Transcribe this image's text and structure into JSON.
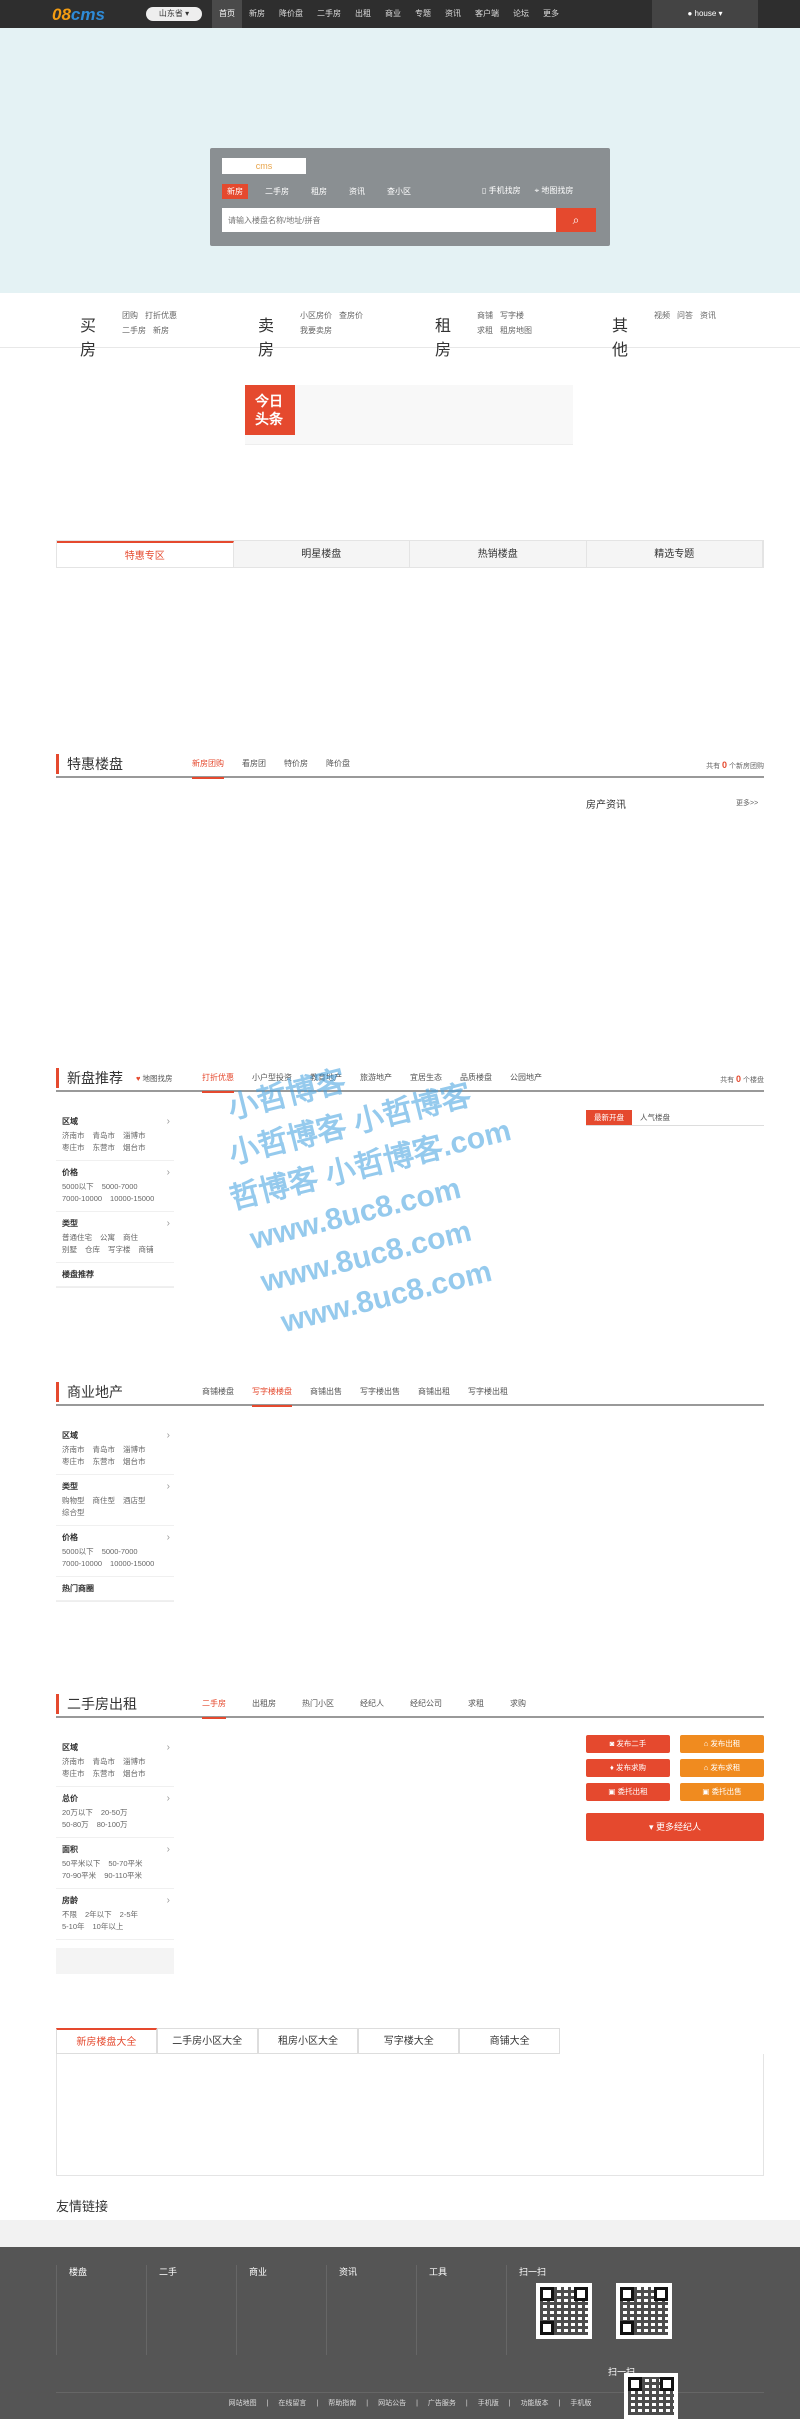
{
  "topbar": {
    "logo_a": "08",
    "logo_b": "cms",
    "city": "山东省",
    "nav": [
      "首页",
      "新房",
      "降价盘",
      "二手房",
      "出租",
      "商业",
      "专题",
      "资讯",
      "客户端",
      "论坛",
      "更多"
    ],
    "user": "house"
  },
  "search": {
    "logo_text": "cms",
    "tabs": [
      "新房",
      "二手房",
      "租房",
      "资讯",
      "查小区"
    ],
    "phone_label": "手机找房",
    "map_label": "地图找房",
    "placeholder": "请输入楼盘名称/地址/拼音"
  },
  "categories": [
    {
      "name": "买房",
      "links": [
        "团购",
        "打折优惠",
        "二手房",
        "新房"
      ]
    },
    {
      "name": "卖房",
      "links": [
        "小区房价",
        "查房价",
        "我要卖房"
      ]
    },
    {
      "name": "租房",
      "links": [
        "商铺",
        "写字楼",
        "求租",
        "租房地图"
      ]
    },
    {
      "name": "其他",
      "links": [
        "视频",
        "问答",
        "资讯"
      ]
    }
  ],
  "headline": {
    "tag1": "今日",
    "tag2": "头条"
  },
  "feature_tabs": [
    "特惠专区",
    "明星楼盘",
    "热销楼盘",
    "精选专题"
  ],
  "tehui": {
    "title": "特惠楼盘",
    "tabs": [
      "新房团购",
      "看房团",
      "特价房",
      "降价盘"
    ],
    "count_pre": "共有",
    "count": "0",
    "count_post": "个新房团购",
    "news_title": "房产资讯",
    "more": "更多>>"
  },
  "newhouse": {
    "title": "新盘推荐",
    "map": "地图找房",
    "tabs": [
      "打折优惠",
      "小户型投资",
      "教育地产",
      "旅游地产",
      "宜居生态",
      "品质楼盘",
      "公园地产"
    ],
    "count_pre": "共有",
    "count": "0",
    "count_post": "个楼盘",
    "mini_tabs": [
      "最新开盘",
      "人气楼盘"
    ],
    "filters": [
      {
        "h": "区域",
        "items": [
          "济南市",
          "青岛市",
          "淄博市",
          "枣庄市",
          "东营市",
          "烟台市"
        ]
      },
      {
        "h": "价格",
        "items": [
          "5000以下",
          "5000-7000",
          "7000-10000",
          "10000-15000"
        ]
      },
      {
        "h": "类型",
        "items": [
          "普通住宅",
          "公寓",
          "商住",
          "别墅",
          "仓库",
          "写字楼",
          "商铺"
        ]
      }
    ],
    "tail": "楼盘推荐"
  },
  "commercial": {
    "title": "商业地产",
    "tabs": [
      "商铺楼盘",
      "写字楼楼盘",
      "商铺出售",
      "写字楼出售",
      "商铺出租",
      "写字楼出租"
    ],
    "filters": [
      {
        "h": "区域",
        "items": [
          "济南市",
          "青岛市",
          "淄博市",
          "枣庄市",
          "东营市",
          "烟台市"
        ]
      },
      {
        "h": "类型",
        "items": [
          "购物型",
          "商住型",
          "酒店型",
          "综合型"
        ]
      },
      {
        "h": "价格",
        "items": [
          "5000以下",
          "5000-7000",
          "7000-10000",
          "10000-15000"
        ]
      }
    ],
    "tail": "热门商圈"
  },
  "resale": {
    "title": "二手房出租",
    "tabs": [
      "二手房",
      "出租房",
      "热门小区",
      "经纪人",
      "经纪公司",
      "求租",
      "求购"
    ],
    "filters": [
      {
        "h": "区域",
        "items": [
          "济南市",
          "青岛市",
          "淄博市",
          "枣庄市",
          "东营市",
          "烟台市"
        ]
      },
      {
        "h": "总价",
        "items": [
          "20万以下",
          "20-50万",
          "50-80万",
          "80-100万"
        ]
      },
      {
        "h": "面积",
        "items": [
          "50平米以下",
          "50-70平米",
          "70-90平米",
          "90-110平米"
        ]
      },
      {
        "h": "房龄",
        "items": [
          "不限",
          "2年以下",
          "2-5年",
          "5-10年",
          "10年以上"
        ]
      }
    ],
    "buttons": [
      "发布二手",
      "发布出租",
      "发布求购",
      "发布求租",
      "委托出租",
      "委托出售"
    ],
    "agent": "更多经纪人"
  },
  "directory_tabs": [
    "新房楼盘大全",
    "二手房小区大全",
    "租房小区大全",
    "写字楼大全",
    "商铺大全"
  ],
  "friend_links": "友情链接",
  "footer": {
    "cols": [
      "楼盘",
      "二手",
      "商业",
      "资讯",
      "工具"
    ],
    "scan": "扫一扫",
    "scan2": "扫一扫",
    "links": [
      "网站地图",
      "在线留言",
      "帮助指南",
      "网站公告",
      "广告服务",
      "手机版",
      "功能版本",
      "手机版"
    ]
  },
  "watermark": [
    "小哲博客",
    "小哲博客 小哲博客",
    "哲博客 小哲博客.com",
    "www.8uc8.com",
    "www.8uc8.com",
    "www.8uc8.com"
  ],
  "colors": {
    "accent": "#e5492e",
    "orange": "#f08b1f",
    "hero_bg": "#e4f2f4",
    "footer_bg": "#555555"
  }
}
